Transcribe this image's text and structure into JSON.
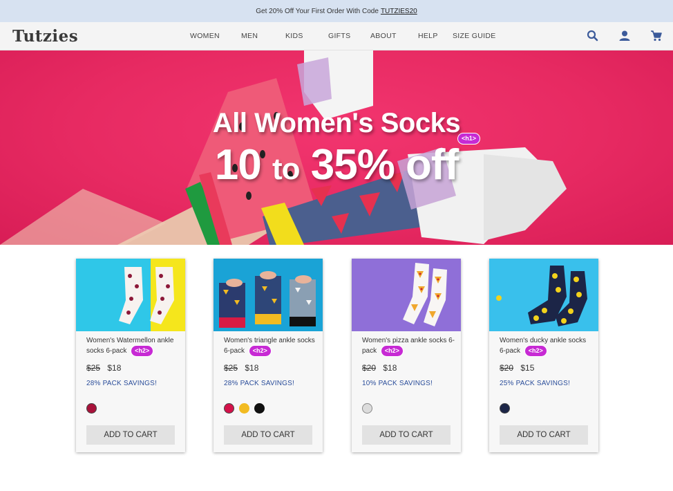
{
  "promo": {
    "text": "Get 20% Off Your First Order With Code",
    "code": "TUTZIES20"
  },
  "header": {
    "logo": "Tutzies",
    "nav": [
      "WOMEN",
      "MEN",
      "KIDS",
      "GIFTS",
      "ABOUT",
      "HELP",
      "SIZE GUIDE"
    ],
    "icons": [
      "search-icon",
      "account-icon",
      "cart-icon"
    ]
  },
  "hero": {
    "title": "All Women's Socks",
    "subtitle_a": "10",
    "subtitle_b": "to",
    "subtitle_c": "35% off",
    "tag": "<h1>",
    "background": "#e72a62"
  },
  "products": [
    {
      "title": "Women's Watermellon ankle socks 6-pack",
      "tag": "<h2>",
      "old_price": "$25",
      "price": "$18",
      "savings": "28% PACK SAVINGS!",
      "swatches": [
        "#a8123a"
      ],
      "button": "ADD TO CART"
    },
    {
      "title": "Women's triangle ankle socks 6-pack",
      "tag": "<h2>",
      "old_price": "$25",
      "price": "$18",
      "savings": "28% PACK SAVINGS!",
      "swatches": [
        "#d4124a",
        "#f2bb22",
        "#111111"
      ],
      "button": "ADD TO CART"
    },
    {
      "title": "Women's pizza ankle socks 6-pack",
      "tag": "<h2>",
      "old_price": "$20",
      "price": "$18",
      "savings": "10% PACK SAVINGS!",
      "swatches": [
        "#dcdcdc"
      ],
      "button": "ADD TO CART"
    },
    {
      "title": "Women's ducky ankle socks 6-pack",
      "tag": "<h2>",
      "old_price": "$20",
      "price": "$15",
      "savings": "25% PACK SAVINGS!",
      "swatches": [
        "#1c2547"
      ],
      "button": "ADD TO CART"
    }
  ],
  "colors": {
    "accent": "#2a4d9a",
    "tag": "#c72ad4",
    "promo_bg": "#d7e2f1"
  }
}
